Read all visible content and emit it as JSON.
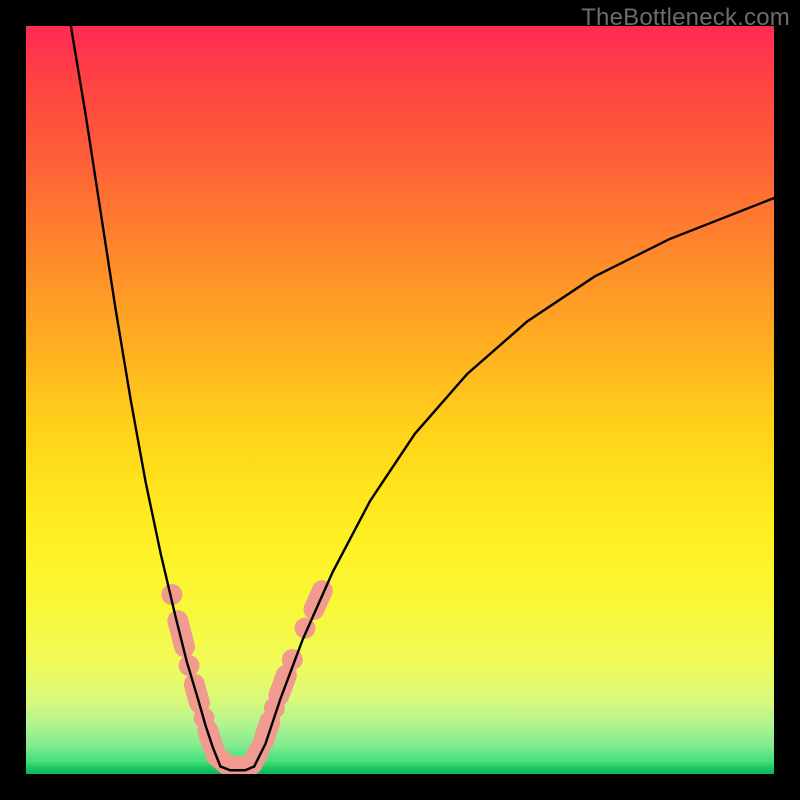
{
  "watermark": "TheBottleneck.com",
  "colors": {
    "background": "#000000",
    "gradient_top": "#ff2a54",
    "gradient_bottom": "#12c662",
    "curve": "#000000",
    "markers": "#f09a90"
  },
  "chart_data": {
    "type": "line",
    "title": "",
    "xlabel": "",
    "ylabel": "",
    "xlim": [
      0,
      100
    ],
    "ylim": [
      0,
      100
    ],
    "grid": false,
    "legend": false,
    "annotations": [],
    "series": [
      {
        "name": "left-branch",
        "x": [
          6.0,
          8.0,
          10.0,
          12.0,
          14.0,
          16.0,
          18.0,
          20.0,
          21.5,
          23.0,
          24.0,
          25.0,
          26.0
        ],
        "y": [
          100,
          88,
          75,
          62,
          50,
          39,
          29.5,
          21,
          15,
          10,
          6.5,
          3.5,
          1.0
        ]
      },
      {
        "name": "valley",
        "x": [
          26.0,
          27.3,
          28.3,
          29.3,
          30.5
        ],
        "y": [
          1.0,
          0.5,
          0.5,
          0.5,
          1.0
        ]
      },
      {
        "name": "right-branch",
        "x": [
          30.5,
          32.0,
          34.0,
          37.0,
          41.0,
          46.0,
          52.0,
          59.0,
          67.0,
          76.0,
          86.0,
          100.0
        ],
        "y": [
          1.0,
          4.0,
          10.0,
          18.0,
          27.0,
          36.5,
          45.5,
          53.5,
          60.5,
          66.5,
          71.5,
          77.0
        ]
      }
    ],
    "markers": {
      "description": "salmon colored dots/pills near the curve minimum",
      "points": [
        {
          "shape": "dot",
          "x": 19.5,
          "y": 24.0,
          "r": 1.4
        },
        {
          "shape": "pill",
          "x1": 20.3,
          "y1": 20.5,
          "x2": 21.2,
          "y2": 17.0,
          "w": 2.8
        },
        {
          "shape": "dot",
          "x": 21.8,
          "y": 14.5,
          "r": 1.4
        },
        {
          "shape": "pill",
          "x1": 22.5,
          "y1": 12.0,
          "x2": 23.2,
          "y2": 9.5,
          "w": 2.8
        },
        {
          "shape": "dot",
          "x": 23.8,
          "y": 7.5,
          "r": 1.4
        },
        {
          "shape": "pill",
          "x1": 24.3,
          "y1": 5.8,
          "x2": 25.0,
          "y2": 3.7,
          "w": 2.8
        },
        {
          "shape": "pill",
          "x1": 25.4,
          "y1": 2.5,
          "x2": 26.8,
          "y2": 1.3,
          "w": 2.8
        },
        {
          "shape": "pill",
          "x1": 27.2,
          "y1": 1.0,
          "x2": 29.6,
          "y2": 1.0,
          "w": 2.8
        },
        {
          "shape": "pill",
          "x1": 30.2,
          "y1": 1.3,
          "x2": 31.2,
          "y2": 3.2,
          "w": 2.8
        },
        {
          "shape": "pill",
          "x1": 31.8,
          "y1": 4.5,
          "x2": 32.6,
          "y2": 7.0,
          "w": 2.8
        },
        {
          "shape": "dot",
          "x": 33.2,
          "y": 8.8,
          "r": 1.4
        },
        {
          "shape": "pill",
          "x1": 33.8,
          "y1": 10.5,
          "x2": 34.8,
          "y2": 13.2,
          "w": 2.8
        },
        {
          "shape": "dot",
          "x": 35.6,
          "y": 15.3,
          "r": 1.4
        },
        {
          "shape": "dot",
          "x": 37.3,
          "y": 19.5,
          "r": 1.4
        },
        {
          "shape": "pill",
          "x1": 38.5,
          "y1": 22.0,
          "x2": 39.6,
          "y2": 24.5,
          "w": 2.8
        }
      ]
    }
  }
}
